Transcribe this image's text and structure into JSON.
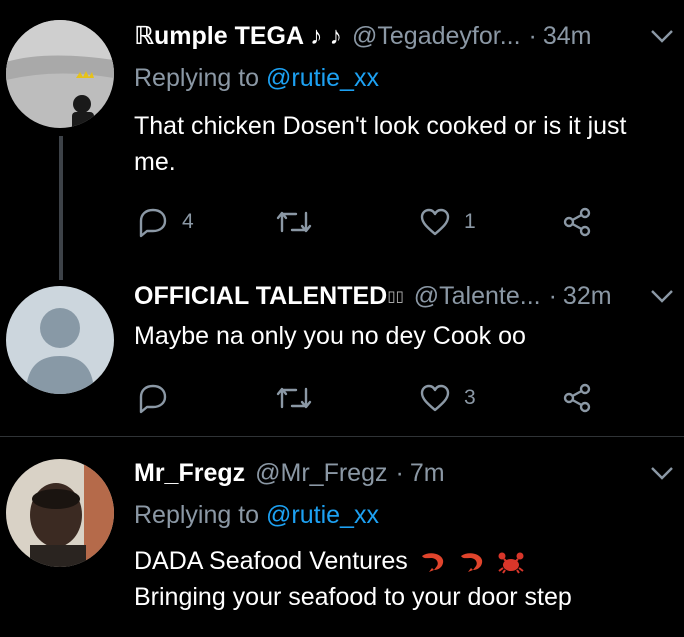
{
  "tweets": [
    {
      "name": "ℝumple TEGA ♪ ♪",
      "handle": "@Tegadeyfor...",
      "time": "34m",
      "replying_label": "Replying to ",
      "replying_to": "@rutie_xx",
      "text": "That chicken Dosen't look cooked or is it just me.",
      "replies": "4",
      "retweets": "",
      "likes": "1",
      "avatar_icon": "user-photo-avatar"
    },
    {
      "name": "OFFICIAL TALENTED",
      "name_suffix": "▯▯",
      "handle": "@Talente...",
      "time": "32m",
      "text": "Maybe na only you no dey Cook oo",
      "replies": "",
      "retweets": "",
      "likes": "3",
      "avatar_icon": "default-user-avatar"
    },
    {
      "name": "Mr_Fregz",
      "handle": "@Mr_Fregz",
      "time": "7m",
      "replying_label": "Replying to ",
      "replying_to": "@rutie_xx",
      "text_line1": "DADA Seafood Ventures",
      "text_line2": "Bringing your seafood to your door step",
      "emojis": [
        "shrimp-emoji",
        "shrimp-emoji",
        "crab-emoji"
      ],
      "avatar_icon": "user-photo-avatar"
    }
  ],
  "colors": {
    "background": "#000000",
    "secondary_text": "#8b98a5",
    "link": "#1da1f2",
    "divider": "#2f3336"
  }
}
